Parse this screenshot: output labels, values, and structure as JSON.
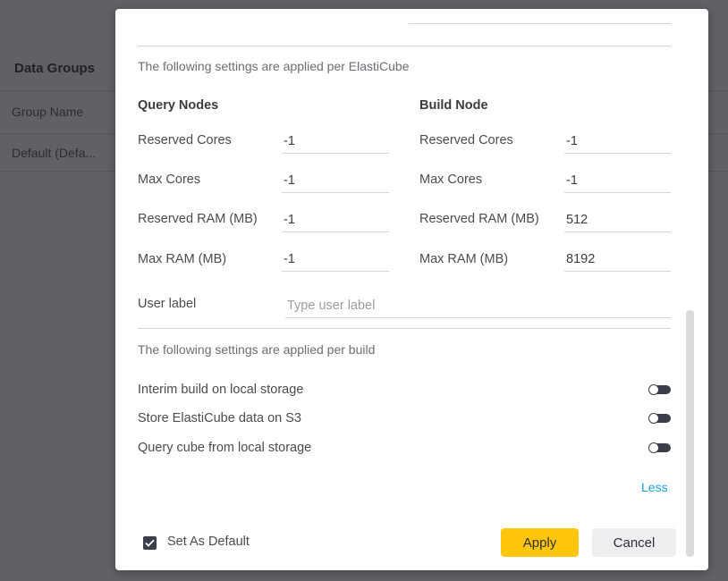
{
  "background": {
    "title": "Data Groups",
    "column_header": "Group Name",
    "rows": [
      "Default (Defa..."
    ]
  },
  "modal": {
    "elasticube_note": "The following settings are applied per ElastiCube",
    "query_nodes": {
      "title": "Query Nodes",
      "reserved_cores_label": "Reserved Cores",
      "reserved_cores_value": "-1",
      "max_cores_label": "Max Cores",
      "max_cores_value": "-1",
      "reserved_ram_label": "Reserved RAM (MB)",
      "reserved_ram_value": "-1",
      "max_ram_label": "Max RAM (MB)",
      "max_ram_value": "-1"
    },
    "build_node": {
      "title": "Build Node",
      "reserved_cores_label": "Reserved Cores",
      "reserved_cores_value": "-1",
      "max_cores_label": "Max Cores",
      "max_cores_value": "-1",
      "reserved_ram_label": "Reserved RAM (MB)",
      "reserved_ram_value": "512",
      "max_ram_label": "Max RAM (MB)",
      "max_ram_value": "8192"
    },
    "user_label": {
      "label": "User label",
      "placeholder": "Type user label",
      "value": ""
    },
    "build_note": "The following settings are applied per build",
    "toggles": [
      {
        "label": "Interim build on local storage",
        "on": false
      },
      {
        "label": "Store ElastiCube data on S3",
        "on": false
      },
      {
        "label": "Query cube from local storage",
        "on": false
      }
    ],
    "less_link": "Less",
    "set_as_default": {
      "label": "Set As Default",
      "checked": true
    },
    "apply_label": "Apply",
    "cancel_label": "Cancel"
  },
  "colors": {
    "accent_yellow": "#ffc60a",
    "link_blue": "#1aa3d9",
    "toggle_dark": "#3b3f4a",
    "overlay": "#5f6164"
  }
}
